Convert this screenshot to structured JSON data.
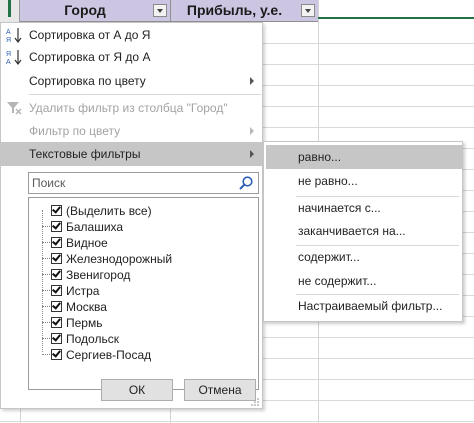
{
  "columns": [
    {
      "label": "Город"
    },
    {
      "label": "Прибыль, у.е."
    }
  ],
  "menu": {
    "sort_az": "Сортировка от А до Я",
    "sort_za": "Сортировка от Я до А",
    "sort_color": "Сортировка по цвету",
    "clear_filter": "Удалить фильтр из столбца \"Город\"",
    "filter_color": "Фильтр по цвету",
    "text_filters": "Текстовые фильтры"
  },
  "search": {
    "placeholder": "Поиск"
  },
  "values": [
    {
      "label": "(Выделить все)",
      "checked": true
    },
    {
      "label": "Балашиха",
      "checked": true
    },
    {
      "label": "Видное",
      "checked": true
    },
    {
      "label": "Железнодорожный",
      "checked": true
    },
    {
      "label": "Звенигород",
      "checked": true
    },
    {
      "label": "Истра",
      "checked": true
    },
    {
      "label": "Москва",
      "checked": true
    },
    {
      "label": "Пермь",
      "checked": true
    },
    {
      "label": "Подольск",
      "checked": true
    },
    {
      "label": "Сергиев-Посад",
      "checked": true
    }
  ],
  "buttons": {
    "ok": "ОК",
    "cancel": "Отмена"
  },
  "submenu": {
    "equals": "равно...",
    "not_equals": "не равно...",
    "begins_with": "начинается с...",
    "ends_with": "заканчивается на...",
    "contains": "содержит...",
    "not_contains": "не содержит...",
    "custom": "Настраиваемый фильтр..."
  },
  "colors": {
    "header_bg": "#ccc6e2",
    "highlight": "#c6c6c6",
    "excel_green": "#217346"
  }
}
